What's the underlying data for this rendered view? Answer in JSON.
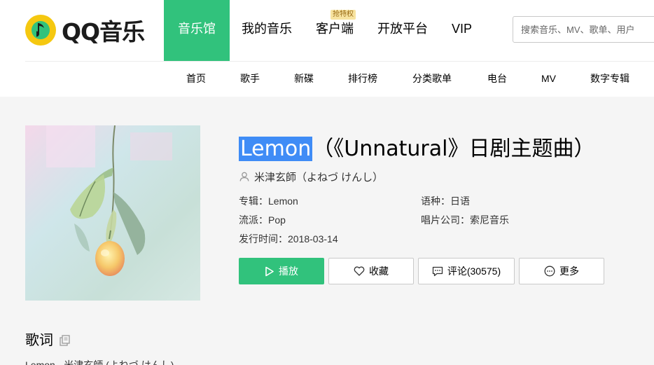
{
  "logo": {
    "text": "QQ音乐",
    "icon": "qq-music-note-icon"
  },
  "nav": {
    "items": [
      {
        "label": "音乐馆",
        "active": true
      },
      {
        "label": "我的音乐"
      },
      {
        "label": "客户端",
        "badge": "抢特权"
      },
      {
        "label": "开放平台"
      },
      {
        "label": "VIP"
      }
    ]
  },
  "search": {
    "placeholder": "搜索音乐、MV、歌单、用户"
  },
  "subnav": {
    "items": [
      "首页",
      "歌手",
      "新碟",
      "排行榜",
      "分类歌单",
      "电台",
      "MV",
      "数字专辑"
    ]
  },
  "song": {
    "title_highlight": "Lemon",
    "title_rest": "（《Unnatural》日剧主题曲）",
    "singer": "米津玄師（よねづ けんし）",
    "album_label": "专辑：",
    "album": "Lemon",
    "language_label": "语种：",
    "language": "日语",
    "genre_label": "流派：",
    "genre": "Pop",
    "company_label": "唱片公司：",
    "company": "索尼音乐",
    "release_label": "发行时间：",
    "release_date": "2018-03-14"
  },
  "actions": {
    "play": "播放",
    "favorite": "收藏",
    "comment": "评论(30575)",
    "more": "更多"
  },
  "lyrics": {
    "heading": "歌词",
    "first_line": "Lemon - 米津玄師 (よねづ けんし)"
  },
  "colors": {
    "accent": "#31c27c",
    "selection": "#3f8cf6",
    "content_bg": "#f5f5f5"
  }
}
